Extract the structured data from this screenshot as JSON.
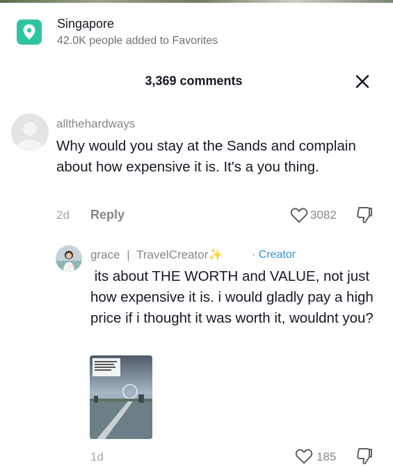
{
  "location": {
    "name": "Singapore",
    "favorites": "42.0K people added to Favorites",
    "icon": "location-pin-icon",
    "accent": "#2ec4a2"
  },
  "comments_panel": {
    "count_label": "3,369 comments",
    "close_icon": "close-icon"
  },
  "comments": [
    {
      "username": "allthehardways",
      "text": "Why would you stay at the Sands and complain about how expensive it is. It's a you thing.",
      "time": "2d",
      "reply_label": "Reply",
      "likes": "3082"
    }
  ],
  "replies": [
    {
      "username": "grace",
      "separator": "|",
      "display_name": "TravelCreator✨",
      "badge": "· Creator",
      "text": " its about THE WORTH and VALUE, not just how expensive it is. i would gladly pay a high price if i thought it was worth it, wouldnt you?",
      "time": "1d",
      "likes": "185"
    }
  ],
  "colors": {
    "text_primary": "#161823",
    "text_secondary": "#86878b",
    "creator_blue": "#2b95d6"
  }
}
